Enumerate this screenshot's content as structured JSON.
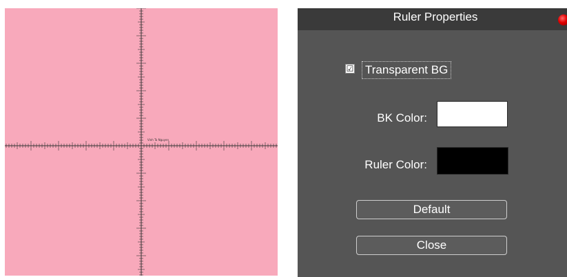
{
  "canvas": {
    "background_color": "#f8a9bb",
    "ruler_color": "#333333",
    "center_label": "Vinh Ta Nguyen"
  },
  "dialog": {
    "title": "Ruler Properties",
    "close_icon": "red-dot-close-icon",
    "transparent_bg": {
      "label": "Transparent BG",
      "checked": true,
      "check_glyph": "☑"
    },
    "bk_color": {
      "label": "BK Color:",
      "value": "#ffffff"
    },
    "ruler_color": {
      "label": "Ruler Color:",
      "value": "#000000"
    },
    "buttons": {
      "default_label": "Default",
      "close_label": "Close"
    }
  }
}
